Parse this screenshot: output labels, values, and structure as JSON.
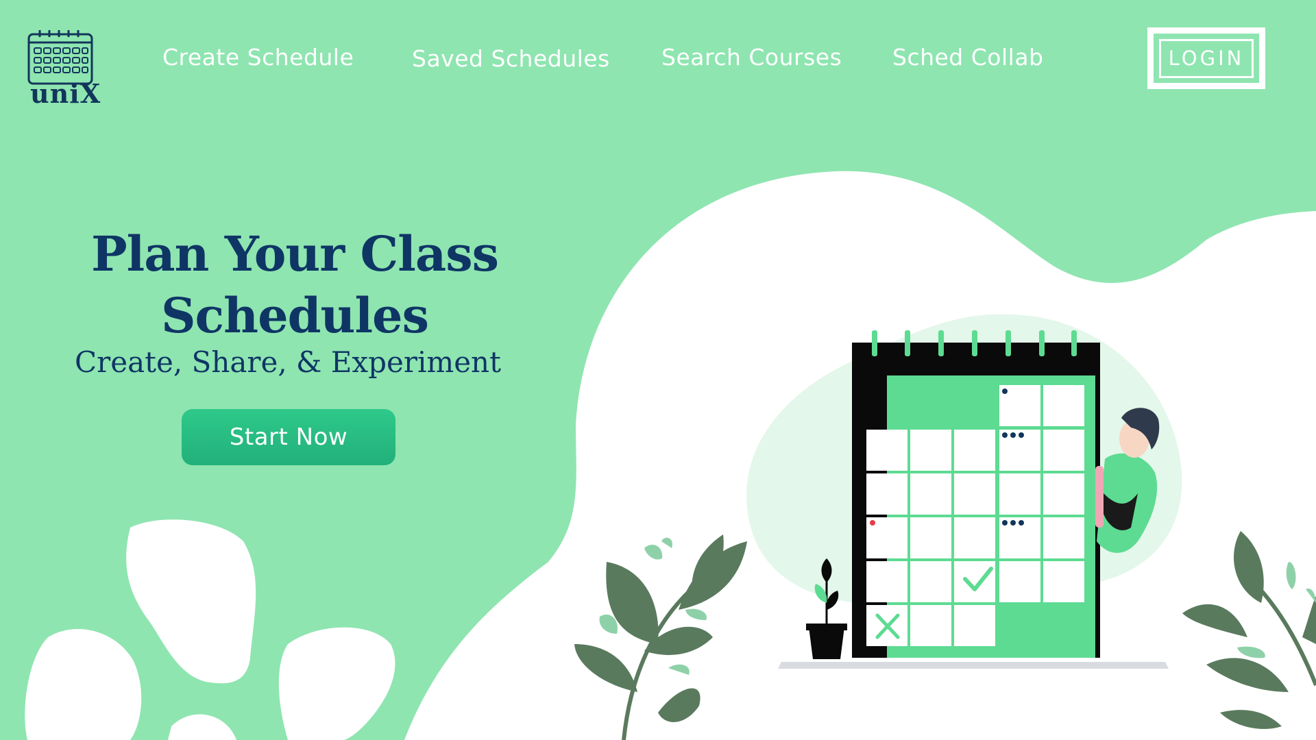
{
  "app": {
    "logo_text": "uniX"
  },
  "nav": {
    "items": [
      {
        "label": "Create Schedule"
      },
      {
        "label": "Saved Schedules"
      },
      {
        "label": "Search Courses"
      },
      {
        "label": "Sched Collab"
      }
    ],
    "login_label": "LOGIN"
  },
  "hero": {
    "title": "Plan Your Class Schedules",
    "subtitle": "Create, Share, & Experiment",
    "cta_label": "Start Now"
  },
  "colors": {
    "background": "#8ee5b0",
    "title": "#0f3565",
    "cta": "#2ec98a",
    "calendar_green": "#5ddb92",
    "leaf": "#5a7a5e"
  },
  "icons": [
    "calendar-icon",
    "check-icon",
    "cross-icon"
  ]
}
